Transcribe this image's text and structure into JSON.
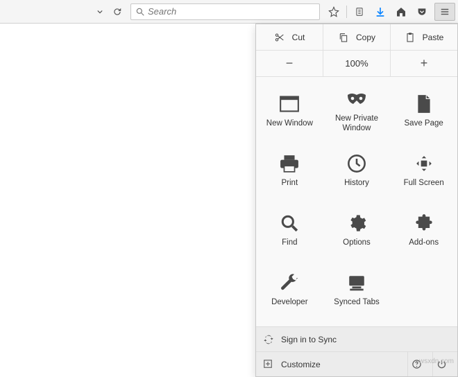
{
  "toolbar": {
    "search_placeholder": "Search"
  },
  "menu": {
    "edit": {
      "cut": "Cut",
      "copy": "Copy",
      "paste": "Paste"
    },
    "zoom": {
      "minus": "−",
      "level": "100%",
      "plus": "+"
    },
    "items": [
      {
        "label": "New Window"
      },
      {
        "label": "New Private Window"
      },
      {
        "label": "Save Page"
      },
      {
        "label": "Print"
      },
      {
        "label": "History"
      },
      {
        "label": "Full Screen"
      },
      {
        "label": "Find"
      },
      {
        "label": "Options"
      },
      {
        "label": "Add-ons"
      },
      {
        "label": "Developer"
      },
      {
        "label": "Synced Tabs"
      }
    ],
    "sign_in": "Sign in to Sync",
    "customize": "Customize"
  },
  "watermark": "wsxdn.com"
}
